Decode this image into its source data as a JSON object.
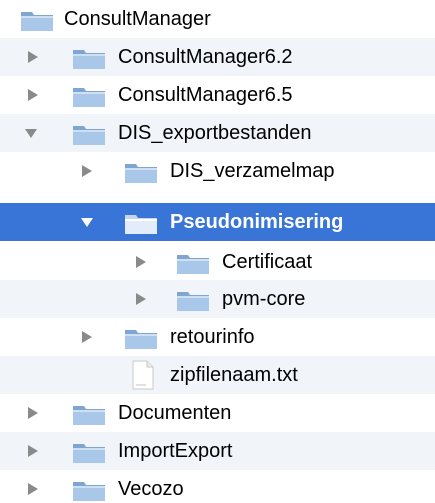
{
  "tree": {
    "items": [
      {
        "label": "ConsultManager",
        "icon": "folder-icon",
        "disclosure": "none"
      },
      {
        "label": "ConsultManager6.2",
        "icon": "folder-icon",
        "disclosure": "collapsed"
      },
      {
        "label": "ConsultManager6.5",
        "icon": "folder-icon",
        "disclosure": "collapsed"
      },
      {
        "label": "DIS_exportbestanden",
        "icon": "folder-icon",
        "disclosure": "expanded"
      },
      {
        "label": "DIS_verzamelmap",
        "icon": "folder-icon",
        "disclosure": "collapsed"
      },
      {
        "label": "Pseudonimisering",
        "icon": "folder-icon",
        "disclosure": "expanded",
        "selected": true
      },
      {
        "label": "Certificaat",
        "icon": "folder-icon",
        "disclosure": "collapsed"
      },
      {
        "label": "pvm-core",
        "icon": "folder-icon",
        "disclosure": "collapsed"
      },
      {
        "label": "retourinfo",
        "icon": "folder-icon",
        "disclosure": "collapsed"
      },
      {
        "label": "zipfilenaam.txt",
        "icon": "text-file-icon",
        "disclosure": "none"
      },
      {
        "label": "Documenten",
        "icon": "folder-icon",
        "disclosure": "collapsed"
      },
      {
        "label": "ImportExport",
        "icon": "folder-icon",
        "disclosure": "collapsed"
      },
      {
        "label": "Vecozo",
        "icon": "folder-icon",
        "disclosure": "collapsed"
      }
    ]
  },
  "colors": {
    "selection": "#3875d7",
    "alternate_row": "#f1f5fa",
    "folder": "#8fb3d9",
    "disclosure": "#8a8a8a"
  }
}
